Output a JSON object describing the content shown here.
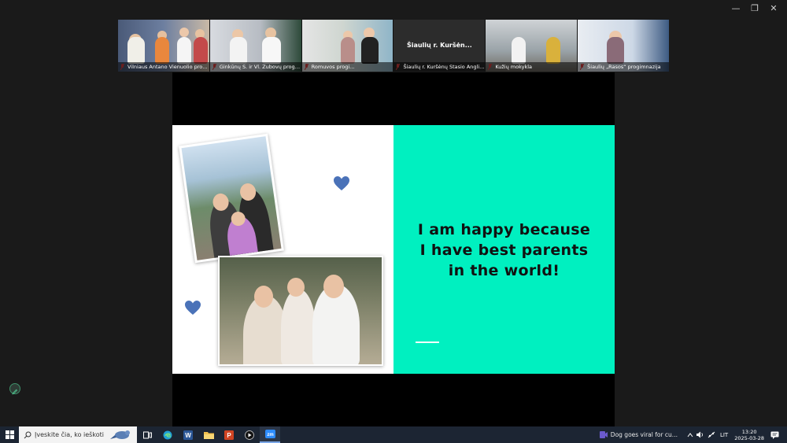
{
  "window": {
    "minimize": "—",
    "restore": "❐",
    "close": "✕"
  },
  "participants": [
    {
      "label": "Vilniaus Antano Vienuolio progi..."
    },
    {
      "label": "Ginkūnų S. ir Vl. Zubovų progim..."
    },
    {
      "label": "Romuvos progi...",
      "active": true
    },
    {
      "label": "Šiaulių r. Kuršėnų Stasio Anglickio...",
      "center_name": "Šiaulių r. Kuršėn..."
    },
    {
      "label": "Kužių mokykla"
    },
    {
      "label": "Šiaulių „Rasos“ progimnazija"
    }
  ],
  "slide": {
    "line1": "I am happy because",
    "line2": "I have best parents",
    "line3": "in the world!",
    "accent_color": "#00f0c0",
    "heart_color": "#4a72b8"
  },
  "taskbar": {
    "search_placeholder": "Įveskite čia, ko ieškoti",
    "news": "Dog goes viral for cu...",
    "language": "LIT",
    "time": "13:20",
    "date": "2025-03-28"
  }
}
